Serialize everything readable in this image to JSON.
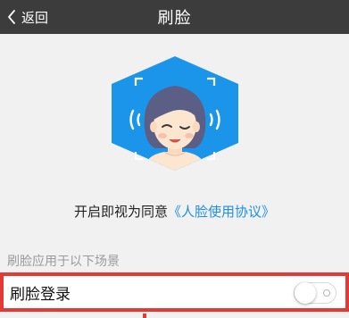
{
  "header": {
    "back_label": "返回",
    "title": "刷脸",
    "back_icon": "chevron-left-icon"
  },
  "hero": {
    "icon": "face-scan-illustration"
  },
  "agreement": {
    "prefix": "开启即视为同意",
    "link": "《人脸使用协议》"
  },
  "section": {
    "label": "刷脸应用于以下场景"
  },
  "setting": {
    "label": "刷脸登录",
    "enabled": false
  },
  "colors": {
    "topbar": "#3c3c3c",
    "accent": "#1f8fe6",
    "highlight": "#e53935",
    "background": "#f1f1f1"
  }
}
